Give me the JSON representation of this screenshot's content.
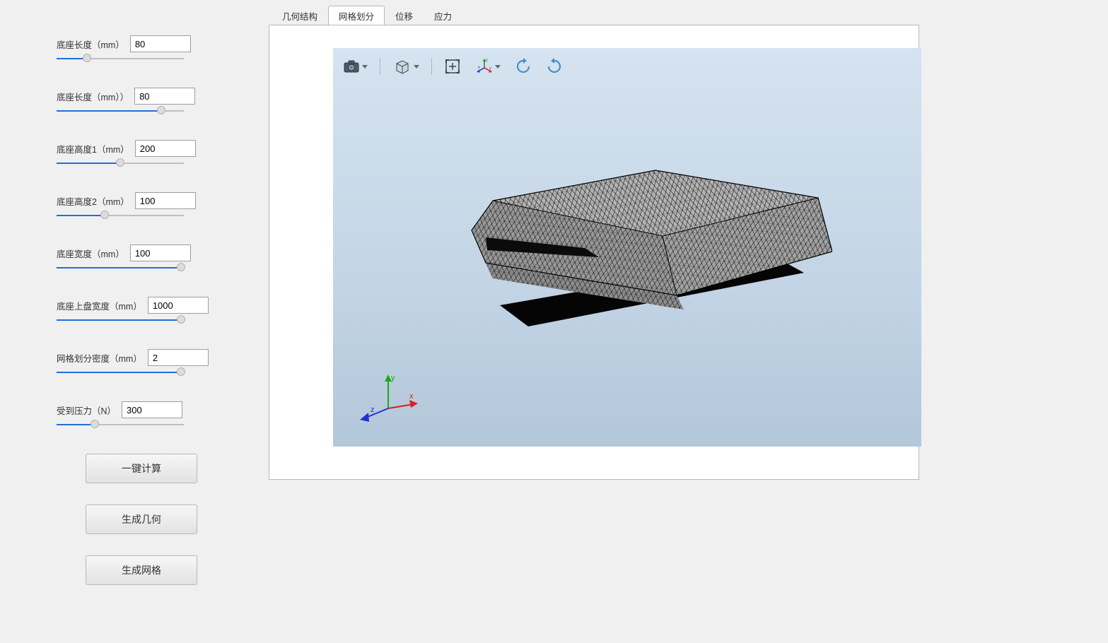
{
  "sidebar": {
    "params": [
      {
        "label": "底座长度（mm）",
        "value": "80",
        "sliderPct": 24
      },
      {
        "label": "底座长度（mm））",
        "value": "80",
        "sliderPct": 82
      },
      {
        "label": "底座高度1（mm）",
        "value": "200",
        "sliderPct": 50
      },
      {
        "label": "底座高度2（mm）",
        "value": "100",
        "sliderPct": 38
      },
      {
        "label": "底座宽度（mm）",
        "value": "100",
        "sliderPct": 98
      },
      {
        "label": "底座上盘宽度（mm）",
        "value": "1000",
        "sliderPct": 98
      },
      {
        "label": "网格划分密度（mm）",
        "value": "2",
        "sliderPct": 98
      },
      {
        "label": "受到压力（N）",
        "value": "300",
        "sliderPct": 30
      }
    ],
    "buttons": {
      "compute": "一键计算",
      "gen_geometry": "生成几何",
      "gen_mesh": "生成网格"
    }
  },
  "tabs": {
    "items": [
      {
        "label": "几何结构",
        "active": false
      },
      {
        "label": "网格划分",
        "active": true
      },
      {
        "label": "位移",
        "active": false
      },
      {
        "label": "应力",
        "active": false
      }
    ]
  },
  "viewer": {
    "axis": {
      "x": "x",
      "y": "y",
      "z": "z"
    }
  }
}
